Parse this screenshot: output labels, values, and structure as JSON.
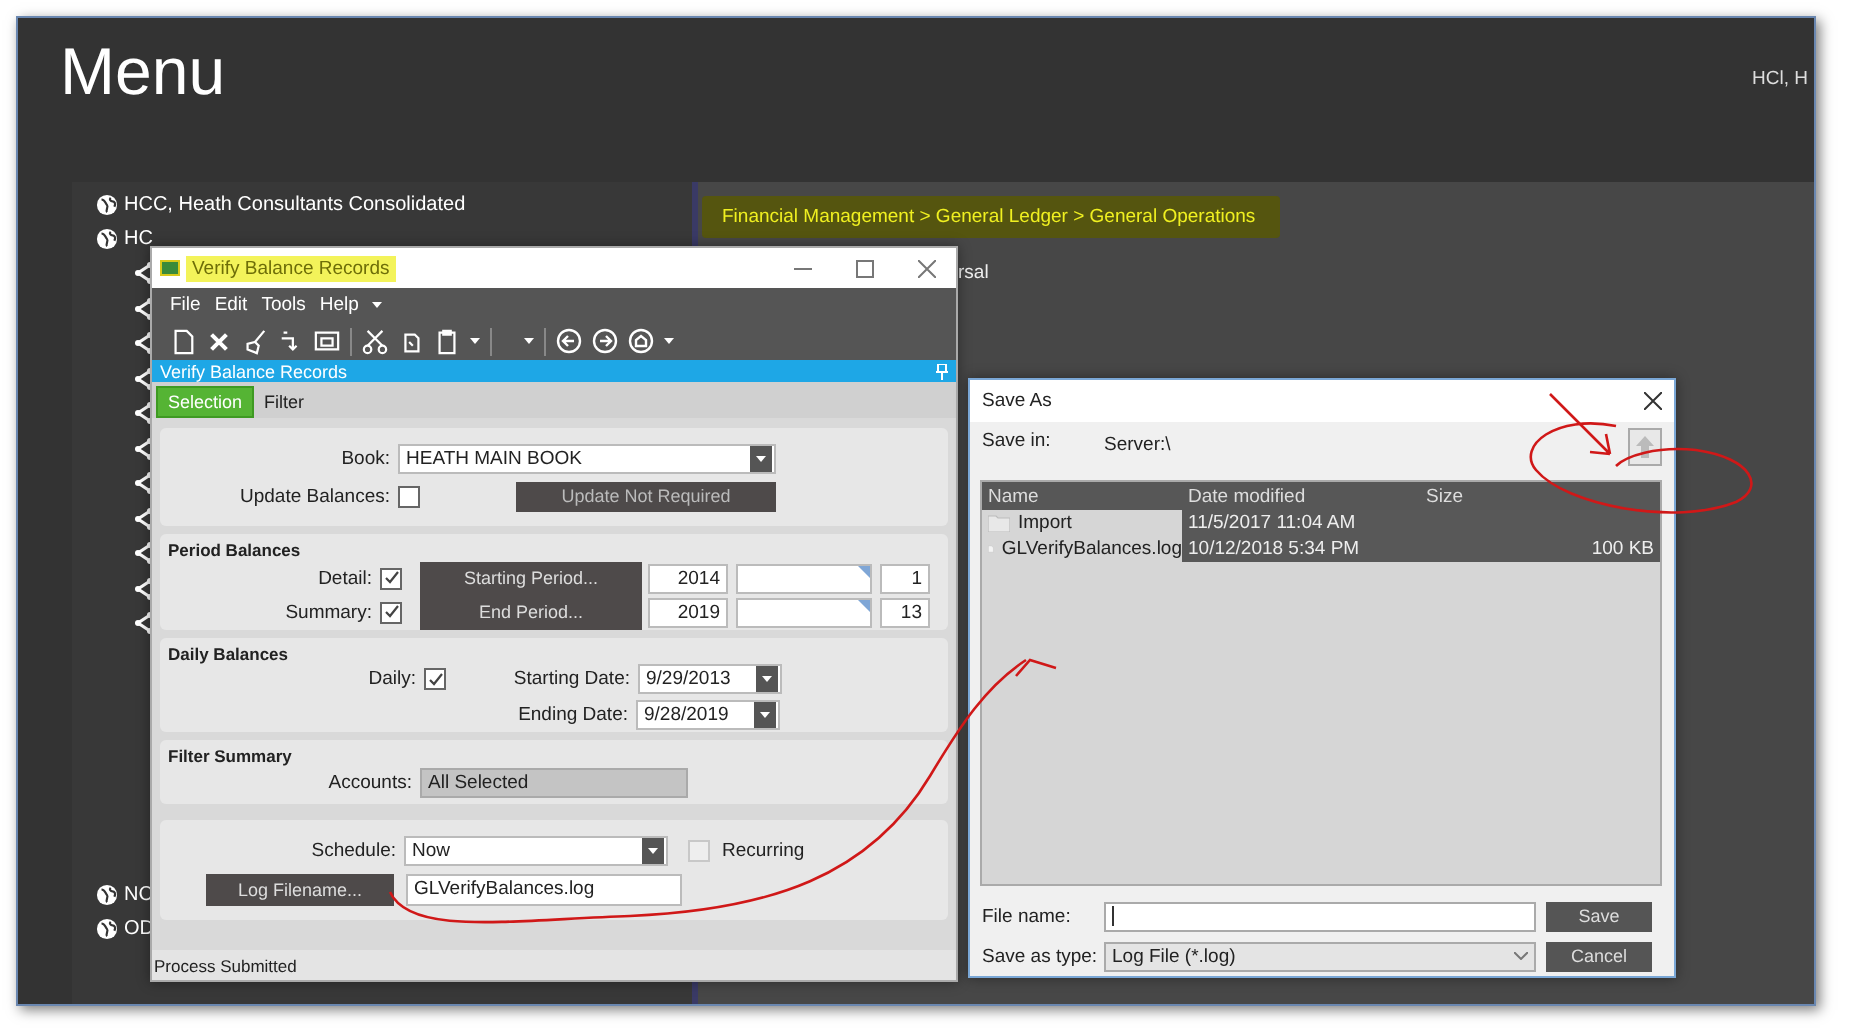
{
  "screen": {
    "title": "Menu",
    "user": "HCl, H"
  },
  "tree": [
    {
      "label": "HCC, Heath Consultants Consolidated"
    },
    {
      "label": "HC"
    },
    {
      "label": "NC"
    },
    {
      "label": "OD"
    }
  ],
  "breadcrumb": "Financial Management > General Ledger > General Operations",
  "behind_text": "rsal",
  "vbr": {
    "title": "Verify Balance Records",
    "menu": [
      "File",
      "Edit",
      "Tools",
      "Help"
    ],
    "panel_title": "Verify Balance Records",
    "tabs": [
      {
        "label": "Selection",
        "selected": true
      },
      {
        "label": "Filter",
        "selected": false
      }
    ],
    "book": {
      "label": "Book:",
      "value": "HEATH MAIN BOOK"
    },
    "update_balances": {
      "label": "Update Balances:",
      "checked": false
    },
    "update_button": "Update Not Required",
    "period": {
      "heading": "Period Balances",
      "rows": [
        {
          "label": "Detail:",
          "checked": true,
          "button": "Starting Period...",
          "year": "2014",
          "period": "1"
        },
        {
          "label": "Summary:",
          "checked": true,
          "button": "End Period...",
          "year": "2019",
          "period": "13"
        }
      ]
    },
    "daily": {
      "heading": "Daily Balances",
      "label": "Daily:",
      "checked": true,
      "dates": [
        {
          "label": "Starting Date:",
          "value": "9/29/2013"
        },
        {
          "label": "Ending Date:",
          "value": "9/28/2019"
        }
      ]
    },
    "filter": {
      "heading": "Filter Summary",
      "label": "Accounts:",
      "value": "All Selected"
    },
    "schedule": {
      "label": "Schedule:",
      "value": "Now",
      "recurring": {
        "label": "Recurring",
        "checked": false,
        "disabled": true
      }
    },
    "log": {
      "button": "Log Filename...",
      "value": "GLVerifyBalances.log"
    },
    "status": "Process Submitted"
  },
  "save_as": {
    "title": "Save As",
    "save_in_label": "Save in:",
    "save_in": "Server:\\",
    "columns": [
      "Name",
      "Date modified",
      "Size"
    ],
    "rows": [
      {
        "kind": "folder",
        "name": "Import",
        "date": "11/5/2017 11:04 AM"
      },
      {
        "kind": "file",
        "name": "GLVerifyBalances.log",
        "date": "10/12/2018 5:34 PM",
        "size": "100 KB"
      }
    ],
    "file_name_label": "File name:",
    "type_label": "Save as type:",
    "type_value": "Log File (*.log)",
    "buttons": [
      "Save",
      "Cancel"
    ]
  }
}
